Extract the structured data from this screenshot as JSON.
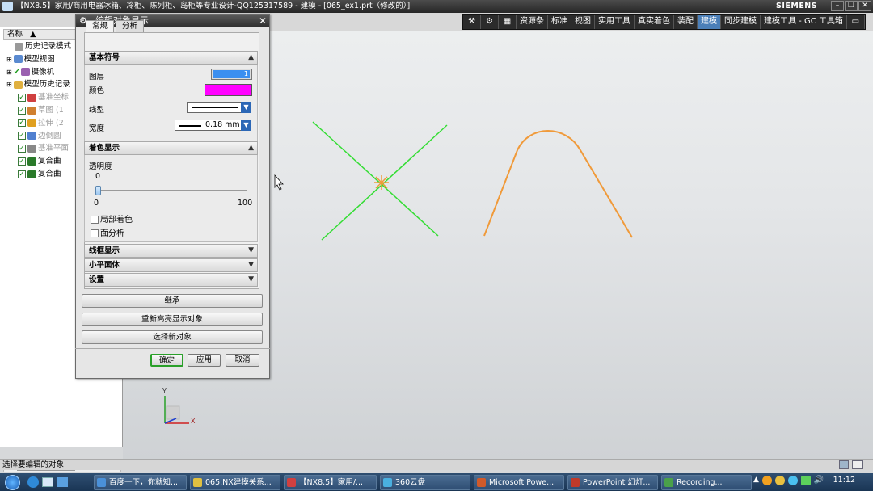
{
  "window": {
    "title": "【NX8.5】家用/商用电器冰箱、冷柜、陈列柜、岛柜等专业设计-QQ125317589 - 建模 - [065_ex1.prt（修改的）]",
    "brand": "SIEMENS"
  },
  "ribbon": [
    "资源条",
    "标准",
    "视图",
    "实用工具",
    "真实着色",
    "装配",
    "建模",
    "同步建模",
    "建模工具 - GC 工具箱"
  ],
  "ribbon_active": "建模",
  "nav": {
    "header": "名称",
    "items": [
      {
        "label": "历史记录模式",
        "icon": "clock-icon",
        "level": 0,
        "gray": false
      },
      {
        "label": "模型视图",
        "icon": "views-icon",
        "level": 0,
        "gray": false
      },
      {
        "label": "摄像机",
        "icon": "camera-icon",
        "level": 0,
        "gray": false
      },
      {
        "label": "模型历史记录",
        "icon": "folder-icon",
        "level": 0,
        "gray": false
      },
      {
        "label": "基准坐标",
        "icon": "datum-csys-icon",
        "level": 1,
        "gray": true
      },
      {
        "label": "草图 (1",
        "icon": "sketch-icon",
        "level": 1,
        "gray": true
      },
      {
        "label": "拉伸 (2",
        "icon": "extrude-icon",
        "level": 1,
        "gray": true
      },
      {
        "label": "边倒圆",
        "icon": "blend-icon",
        "level": 1,
        "gray": true
      },
      {
        "label": "基准平面",
        "icon": "datum-plane-icon",
        "level": 1,
        "gray": true
      },
      {
        "label": "复合曲",
        "icon": "curve-icon",
        "level": 1,
        "gray": false
      },
      {
        "label": "复合曲",
        "icon": "curve-icon",
        "level": 1,
        "gray": false
      }
    ]
  },
  "dialog": {
    "title": "编辑对象显示",
    "tabs": [
      "常规",
      "分析"
    ],
    "sections": {
      "basic": "基本符号",
      "shading": "着色显示",
      "wire": "线框显示",
      "facet": "小平面体",
      "settings": "设置"
    },
    "layer": {
      "label": "图层",
      "value": "1"
    },
    "color": {
      "label": "颜色",
      "value": "#ff00ff"
    },
    "linetype": {
      "label": "线型"
    },
    "width": {
      "label": "宽度",
      "value": "0.18 mm"
    },
    "transparency": {
      "label": "透明度",
      "value": "0",
      "min": "0",
      "max": "100",
      "level": 0
    },
    "partial": "局部着色",
    "face_analysis": "面分析",
    "buttons": {
      "inherit": "继承",
      "rehighlight": "重新高亮显示对象",
      "reselect": "选择新对象",
      "ok": "确定",
      "apply": "应用",
      "cancel": "取消"
    }
  },
  "axes": {
    "x": "X",
    "y": "Y"
  },
  "status": "选择要编辑的对象",
  "taskbar": {
    "items": [
      "百度一下，你就知...",
      "065.NX建模关系...",
      "【NX8.5】家用/...",
      "360云盘",
      "Microsoft Powe...",
      "PowerPoint 幻灯...",
      "Recording..."
    ],
    "clock": "11:12"
  },
  "colors": {
    "selected_curves": "#33dd33",
    "curve": "#f09a3a",
    "ribbon_active": "#4b7fb8"
  }
}
